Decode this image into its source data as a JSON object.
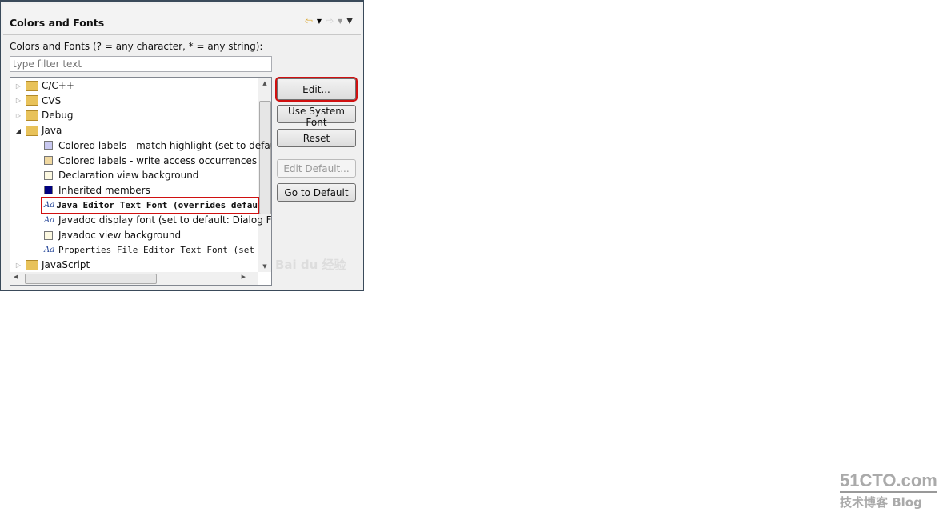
{
  "header": {
    "title": "Colors and Fonts",
    "back_icon": "back-arrow-icon",
    "forward_icon": "forward-arrow-icon",
    "menu_icon": "view-menu-icon"
  },
  "filter": {
    "label": "Colors and Fonts (? = any character, * = any string):",
    "placeholder": "type filter text",
    "value": ""
  },
  "tree": [
    {
      "label": "C/C++",
      "type": "category",
      "expanded": false
    },
    {
      "label": "CVS",
      "type": "category",
      "expanded": false
    },
    {
      "label": "Debug",
      "type": "category",
      "expanded": false
    },
    {
      "label": "Java",
      "type": "category",
      "expanded": true
    },
    {
      "label": "Colored labels - match highlight (set to defau",
      "type": "color",
      "color": "#c8c8f0"
    },
    {
      "label": "Colored labels - write access occurrences",
      "type": "color",
      "color": "#f0d8a0"
    },
    {
      "label": "Declaration view background",
      "type": "color",
      "color": "#fcf8e0"
    },
    {
      "label": "Inherited members",
      "type": "color",
      "color": "#000080"
    },
    {
      "label": "Java Editor Text Font (overrides defau",
      "type": "font",
      "selected": true
    },
    {
      "label": "Javadoc display font (set to default: Dialog Fo",
      "type": "font"
    },
    {
      "label": "Javadoc view background",
      "type": "color",
      "color": "#fcf8e0"
    },
    {
      "label": "Properties File Editor Text Font (set",
      "type": "font"
    },
    {
      "label": "JavaScript",
      "type": "category",
      "expanded": false
    }
  ],
  "buttons": {
    "edit": "Edit...",
    "use_system_font": "Use System Font",
    "reset": "Reset",
    "edit_default": "Edit Default...",
    "go_to_default": "Go to Default"
  },
  "watermarks": {
    "baidu": "Bai du 经验",
    "site": "51CTO.com",
    "blog": "技术博客 Blog"
  }
}
